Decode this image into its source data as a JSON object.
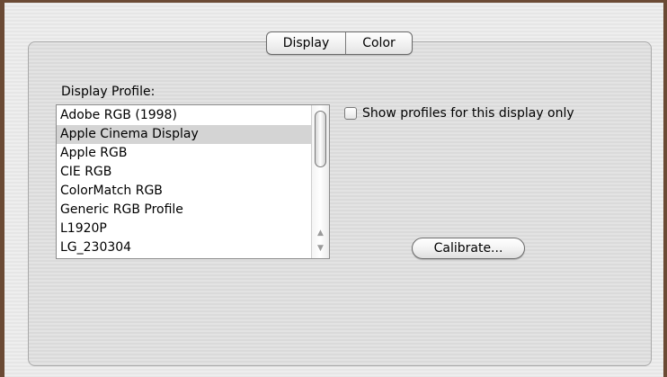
{
  "tabs": [
    {
      "label": "Display",
      "selected": false
    },
    {
      "label": "Color",
      "selected": true
    }
  ],
  "display_profile": {
    "label": "Display Profile:",
    "items": [
      "Adobe RGB (1998)",
      "Apple Cinema Display",
      "Apple RGB",
      "CIE RGB",
      "ColorMatch RGB",
      "Generic RGB Profile",
      "L1920P",
      "LG_230304"
    ],
    "selected": "Apple Cinema Display"
  },
  "show_profiles_checkbox": {
    "label": "Show profiles for this display only",
    "checked": false
  },
  "calibrate_button": {
    "label": "Calibrate..."
  },
  "colors": {
    "window_frame": "#6b4a34",
    "selection": "#d4d4d4"
  }
}
